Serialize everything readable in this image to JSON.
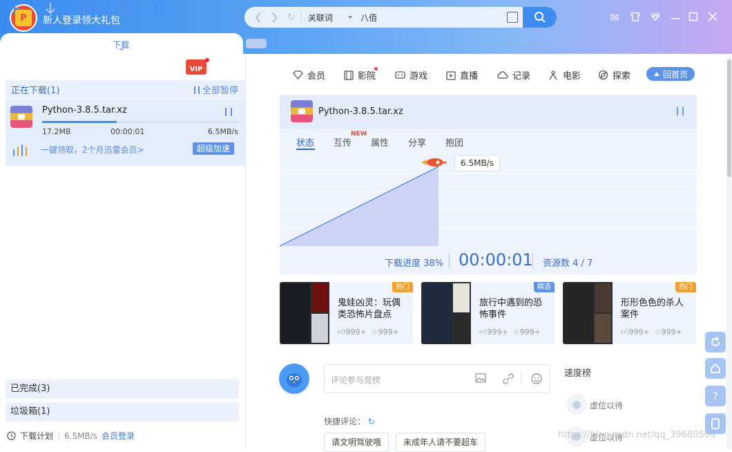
{
  "title_bar": {
    "gift_text": "新人登录领大礼包",
    "logo_text": "P",
    "search": {
      "category": "关联词",
      "query": "八佰"
    },
    "window_controls": [
      "mail-icon",
      "skin-icon",
      "menu-icon",
      "minimize-icon",
      "maximize-icon",
      "close-icon"
    ]
  },
  "tabs": {
    "active": "下载"
  },
  "left_panel": {
    "downloading_header": "正在下载(1)",
    "pause_all": "全部暂停",
    "download_item": {
      "name": "Python-3.8.5.tar.xz",
      "size": "17.2MB",
      "time": "00:00:01",
      "speed": "6.5MB/s",
      "progress": 0.38,
      "promo_text": "一键领取，2个月迅雷会员>",
      "boost_button": "超级加速"
    },
    "completed": "已完成(3)",
    "trash": "垃圾箱(1)",
    "footer": {
      "plan": "下载计划",
      "speed": "6.5MB/s",
      "login": "会员登录"
    },
    "toolbar_vip": "VIP"
  },
  "right_panel": {
    "menu": [
      {
        "label": "会员",
        "icon": "diamond-icon"
      },
      {
        "label": "影院",
        "icon": "film-icon"
      },
      {
        "label": "游戏",
        "icon": "gamepad-icon"
      },
      {
        "label": "直播",
        "icon": "live-icon"
      },
      {
        "label": "记录",
        "icon": "cloud-icon"
      },
      {
        "label": "电影",
        "icon": "movie-icon"
      },
      {
        "label": "探索",
        "icon": "explore-icon"
      }
    ],
    "home_button": "回首页",
    "task": {
      "name": "Python-3.8.5.tar.xz",
      "subtabs": [
        "状态",
        "互传",
        "属性",
        "分享",
        "抱团"
      ],
      "new_tag": "NEW",
      "speed": "6.5MB/s",
      "progress_label": "下载进度 38%",
      "elapsed": "00:00:01",
      "resources": "资源数 4 / 7",
      "chart_progress": 0.38
    },
    "cards": [
      {
        "title": "鬼娃凶灵：玩偶类恐怖片盘点",
        "likes": "999+",
        "stars": "999+",
        "badge": "热门",
        "badge_color": "#f0a22e"
      },
      {
        "title": "旅行中遇到的恐怖事件",
        "likes": "999+",
        "stars": "999+",
        "badge": "精选",
        "badge_color": "#5c93e6"
      },
      {
        "title": "形形色色的杀人案件",
        "likes": "999+",
        "stars": "999+",
        "badge": "热门",
        "badge_color": "#f0a22e"
      }
    ],
    "comment": {
      "placeholder": "评论参与竞榜",
      "quick_label": "快捷评论：",
      "chips": [
        "请文明驾驶哦",
        "未成年人请不要超车"
      ]
    },
    "rank": {
      "title": "速度榜",
      "items": [
        "虚位以待",
        "虚位以待"
      ]
    },
    "watermark": "https://blog.csdn.net/qq_39680564"
  }
}
